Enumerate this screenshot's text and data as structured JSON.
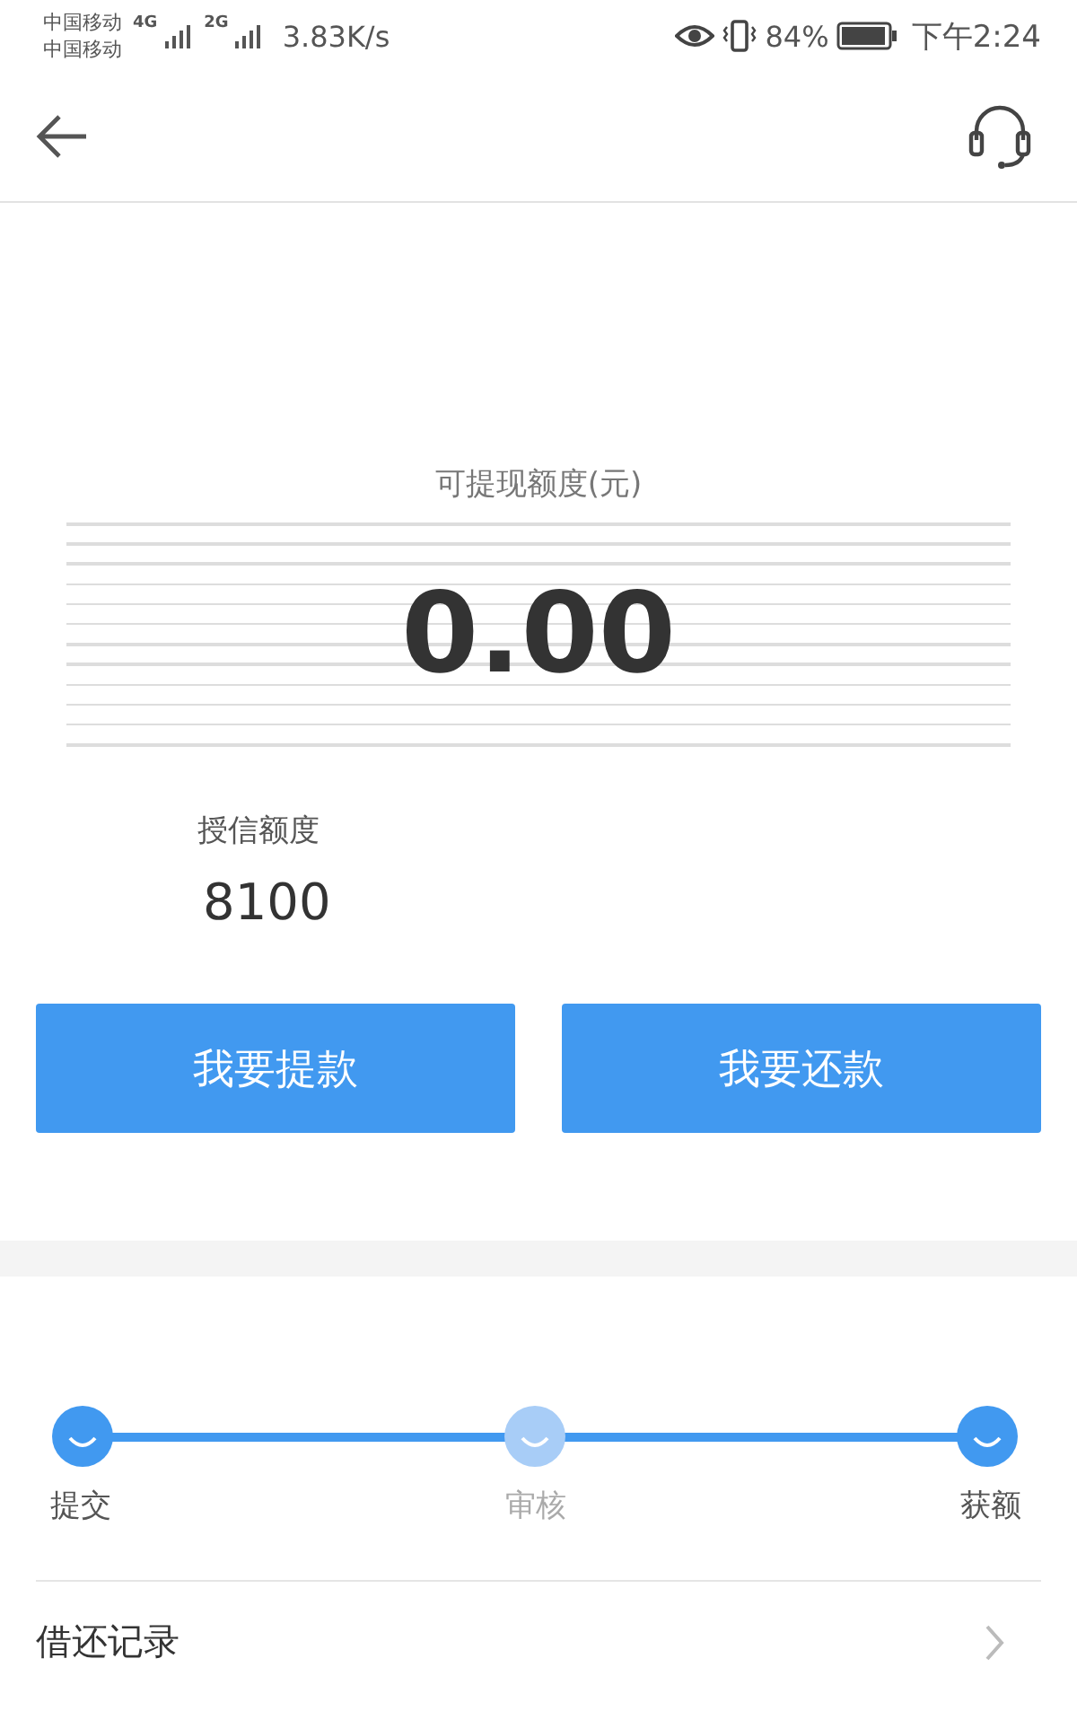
{
  "status_bar": {
    "carriers": [
      "中国移动",
      "中国移动"
    ],
    "network_labels": [
      "4G",
      "2G"
    ],
    "speed": "3.83K/s",
    "battery_percent": "84%",
    "time": "下午2:24"
  },
  "balance": {
    "label": "可提现额度(元)",
    "amount": "0.00"
  },
  "credit": {
    "label": "授信额度",
    "amount": "8100"
  },
  "buttons": [
    "我要提款",
    "我要还款"
  ],
  "steps": [
    {
      "label": "提交",
      "done": true
    },
    {
      "label": "审核",
      "done": false
    },
    {
      "label": "获额",
      "done": true
    }
  ],
  "records_link": {
    "label": "借还记录"
  }
}
